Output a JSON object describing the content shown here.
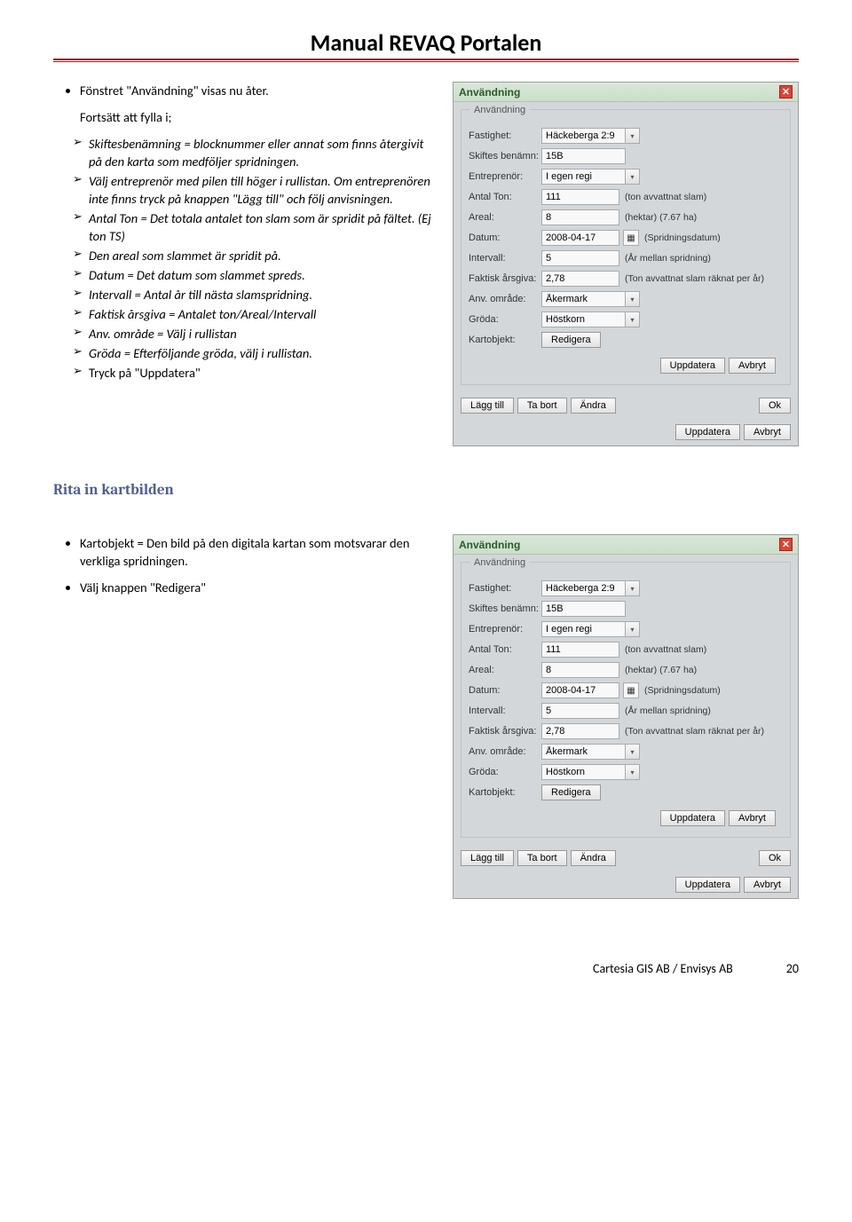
{
  "header": {
    "title": "Manual REVAQ Portalen"
  },
  "s1": {
    "intro_bullet": "Fönstret \"Användning\" visas nu åter.",
    "continue": "Fortsätt att fylla i;",
    "items": [
      "Skiftesbenämning = blocknummer eller annat som finns återgivit på den karta som medföljer spridningen.",
      "Välj entreprenör med pilen till höger i rullistan. Om entreprenören inte finns tryck på knappen \"Lägg till\" och följ anvisningen.",
      "Antal Ton = Det totala antalet ton slam som är spridit på fältet. (Ej ton TS)",
      "Den areal som slammet är spridit på.",
      "Datum = Det datum som slammet spreds.",
      "Intervall = Antal år till nästa slamspridning.",
      "Faktisk årsgiva = Antalet ton/Areal/Intervall",
      "Anv. område = Välj i rullistan",
      "Gröda = Efterföljande gröda, välj i rullistan.",
      "Tryck på \"Uppdatera\""
    ]
  },
  "s2": {
    "heading": "Rita in kartbilden",
    "bul1": "Kartobjekt =  Den bild på den digitala kartan som motsvarar den verkliga spridningen.",
    "bul2": "Välj knappen \"Redigera\""
  },
  "dlg": {
    "title": "Användning",
    "legend": "Användning",
    "labels": {
      "fastighet": "Fastighet:",
      "skiftes": "Skiftes benämn:",
      "entreprenor": "Entreprenör:",
      "antalton": "Antal Ton:",
      "areal": "Areal:",
      "datum": "Datum:",
      "intervall": "Intervall:",
      "faktisk": "Faktisk årsgiva:",
      "anv": "Anv. område:",
      "groda": "Gröda:",
      "kartobjekt": "Kartobjekt:"
    },
    "vals": {
      "fastighet": "Häckeberga 2:9",
      "skiftes": "15B",
      "entreprenor": "I egen regi",
      "antalton": "111",
      "areal": "8",
      "datum": "2008-04-17",
      "intervall": "5",
      "faktisk": "2,78",
      "anv": "Åkermark",
      "groda": "Höstkorn"
    },
    "suffix": {
      "antalton": "(ton avvattnat slam)",
      "areal": "(hektar) (7.67 ha)",
      "datum": "(Spridningsdatum)",
      "intervall": "(År mellan spridning)",
      "faktisk": "(Ton avvattnat slam räknat per år)"
    },
    "btns": {
      "redigera": "Redigera",
      "uppdatera": "Uppdatera",
      "avbryt": "Avbryt",
      "laggtill": "Lägg till",
      "tabort": "Ta bort",
      "andra": "Ändra",
      "ok": "Ok"
    }
  },
  "footer": {
    "company": "Cartesia GIS AB  / Envisys AB",
    "page": "20"
  }
}
